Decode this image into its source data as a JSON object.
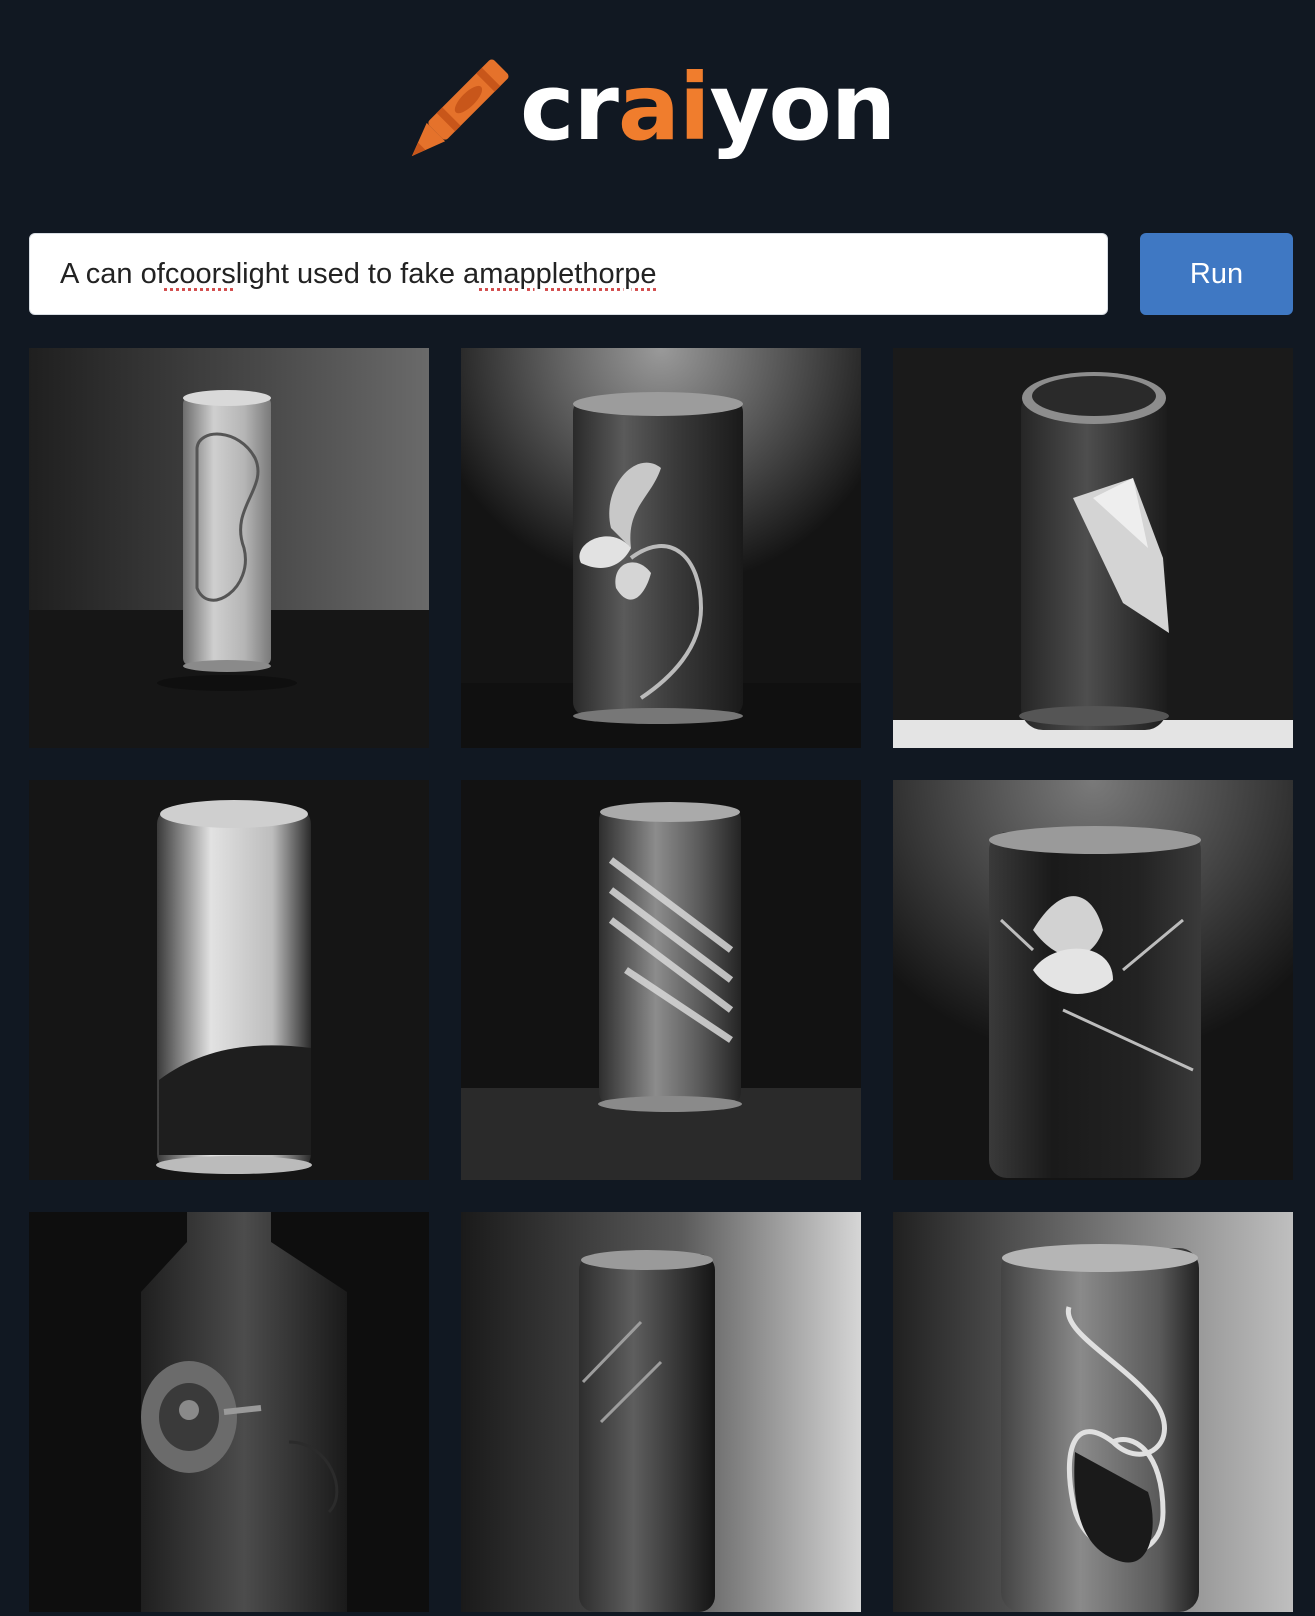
{
  "app": {
    "name": "craiyon"
  },
  "logo": {
    "parts": {
      "before": "cr",
      "accent": "ai",
      "after": "yon"
    },
    "accent_color": "#f07d2d",
    "icon": "crayon-icon"
  },
  "search": {
    "value_parts": [
      "A can of ",
      "coors",
      " light used to fake a ",
      "mapplethorpe"
    ]
  },
  "run_button": {
    "label": "Run",
    "color": "#3f78c3"
  },
  "results": {
    "count": 9,
    "images": [
      "generated-image-1",
      "generated-image-2",
      "generated-image-3",
      "generated-image-4",
      "generated-image-5",
      "generated-image-6",
      "generated-image-7",
      "generated-image-8",
      "generated-image-9"
    ]
  },
  "colors": {
    "background": "#111822",
    "accent": "#f07d2d",
    "button": "#3f78c3"
  }
}
